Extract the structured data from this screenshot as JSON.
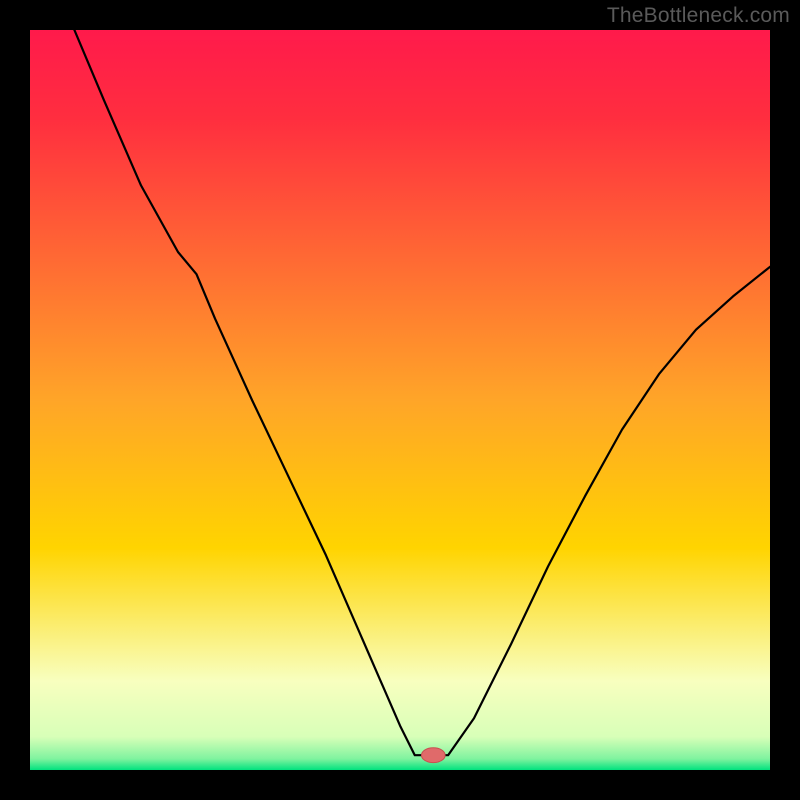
{
  "watermark": "TheBottleneck.com",
  "colors": {
    "frame": "#000000",
    "watermark": "#5a5a5a",
    "gradient_top": "#ff1a4b",
    "gradient_mid": "#ffd400",
    "gradient_low": "#f8ffbf",
    "gradient_bottom_edge": "#00e27e",
    "curve": "#000000",
    "curve_width": 2.2,
    "marker_fill": "#e06a6a",
    "marker_stroke": "#c94f4f"
  },
  "chart_data": {
    "type": "line",
    "title": "",
    "xlabel": "",
    "ylabel": "",
    "xlim": [
      0,
      1
    ],
    "ylim": [
      0,
      1
    ],
    "series": [
      {
        "name": "left-branch",
        "x": [
          0.06,
          0.1,
          0.15,
          0.2,
          0.225,
          0.25,
          0.3,
          0.35,
          0.4,
          0.45,
          0.5,
          0.52
        ],
        "y": [
          1.0,
          0.905,
          0.79,
          0.7,
          0.67,
          0.61,
          0.5,
          0.395,
          0.29,
          0.175,
          0.06,
          0.02
        ]
      },
      {
        "name": "valley-floor",
        "x": [
          0.52,
          0.565
        ],
        "y": [
          0.02,
          0.02
        ]
      },
      {
        "name": "right-branch",
        "x": [
          0.565,
          0.6,
          0.65,
          0.7,
          0.75,
          0.8,
          0.85,
          0.9,
          0.95,
          1.0
        ],
        "y": [
          0.02,
          0.07,
          0.17,
          0.275,
          0.37,
          0.46,
          0.535,
          0.595,
          0.64,
          0.68
        ]
      }
    ],
    "marker": {
      "x": 0.545,
      "y": 0.02,
      "rx": 0.016,
      "ry": 0.01
    },
    "gradient_stops": [
      {
        "offset": 0.0,
        "color": "#ff1a4b"
      },
      {
        "offset": 0.12,
        "color": "#ff2e3f"
      },
      {
        "offset": 0.5,
        "color": "#ffa528"
      },
      {
        "offset": 0.7,
        "color": "#ffd400"
      },
      {
        "offset": 0.88,
        "color": "#f8ffbf"
      },
      {
        "offset": 0.955,
        "color": "#d8ffb8"
      },
      {
        "offset": 0.985,
        "color": "#7ff39f"
      },
      {
        "offset": 1.0,
        "color": "#00e27e"
      }
    ]
  }
}
